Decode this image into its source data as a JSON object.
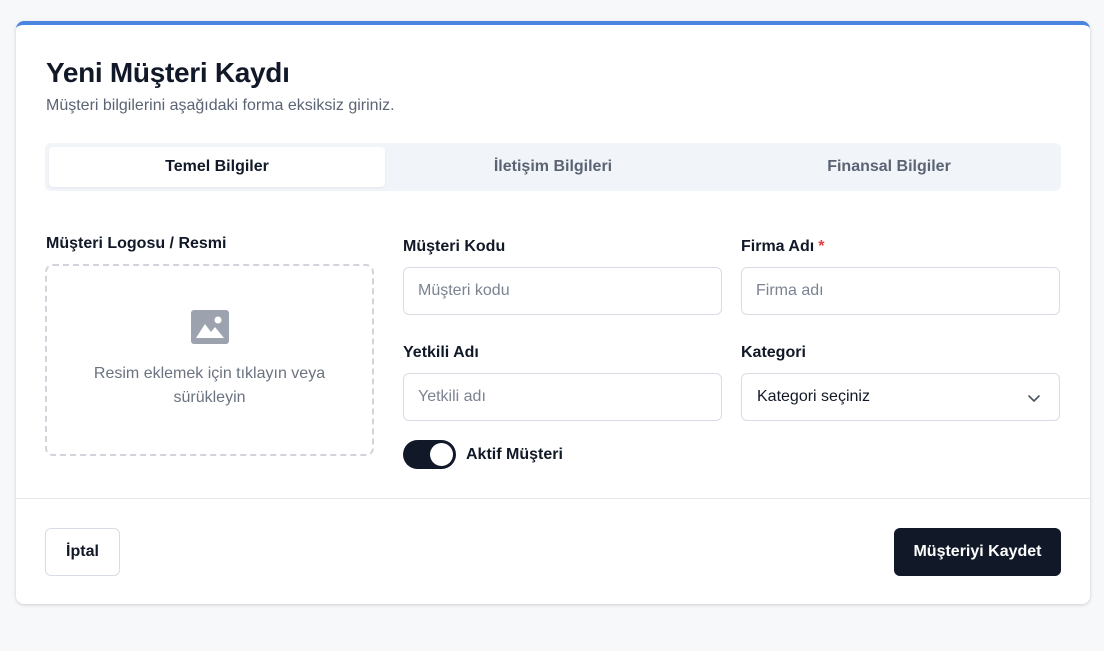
{
  "header": {
    "title": "Yeni Müşteri Kaydı",
    "subtitle": "Müşteri bilgilerini aşağıdaki forma eksiksiz giriniz."
  },
  "tabs": [
    {
      "label": "Temel Bilgiler",
      "active": true
    },
    {
      "label": "İletişim Bilgileri",
      "active": false
    },
    {
      "label": "Finansal Bilgiler",
      "active": false
    }
  ],
  "logo": {
    "label": "Müşteri Logosu / Resmi",
    "dropzone_text": "Resim eklemek için tıklayın veya sürükleyin",
    "icon": "image-icon"
  },
  "fields": {
    "customer_code": {
      "label": "Müşteri Kodu",
      "placeholder": "Müşteri kodu",
      "value": ""
    },
    "company_name": {
      "label": "Firma Adı",
      "required_mark": "*",
      "placeholder": "Firma adı",
      "value": ""
    },
    "contact_name": {
      "label": "Yetkili Adı",
      "placeholder": "Yetkili adı",
      "value": ""
    },
    "category": {
      "label": "Kategori",
      "selected": "Kategori seçiniz",
      "icon": "chevron-down-icon"
    }
  },
  "active_toggle": {
    "label": "Aktif Müşteri",
    "on": true
  },
  "footer": {
    "cancel_label": "İptal",
    "save_label": "Müşteriyi Kaydet"
  },
  "colors": {
    "accent_top": "#4a86e0",
    "primary": "#111827",
    "required": "#e53e3e"
  }
}
